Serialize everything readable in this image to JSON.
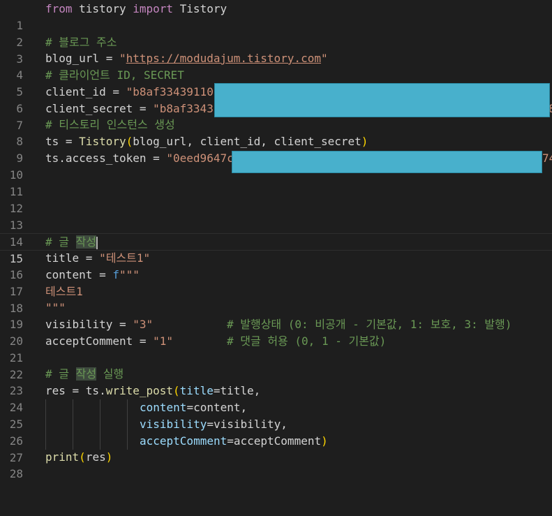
{
  "line_numbers": [
    "1",
    "2",
    "3",
    "4",
    "5",
    "6",
    "7",
    "8",
    "9",
    "10",
    "11",
    "12",
    "13",
    "14",
    "15",
    "16",
    "17",
    "18",
    "19",
    "20",
    "21",
    "22",
    "23",
    "24",
    "25",
    "26",
    "27",
    "28"
  ],
  "code": {
    "l1_from": "from",
    "l1_module": " tistory ",
    "l1_import": "import",
    "l1_class": " Tistory",
    "l3_comment": "# 블로그 주소",
    "l4_var": "blog_url = ",
    "l4_q1": "\"",
    "l4_url": "https://modudajum.tistory.com",
    "l4_q2": "\"",
    "l5_comment": "# 클라이언트 ID, SECRET",
    "l6_var": "client_id = ",
    "l6_str": "\"b8af33439110",
    "l7_var": "client_secret = ",
    "l7_str": "\"b8af3343",
    "l7_tail": "8",
    "l8_comment": "# 티스토리 인스턴스 생성",
    "l9_a": "ts = ",
    "l9_fn": "Tistory",
    "l9_p1": "(",
    "l9_args": "blog_url, client_id, client_secret",
    "l9_p2": ")",
    "l10_var": "ts.access_token = ",
    "l10_str": "\"0eed9647c",
    "l10_tail": "74",
    "l15_c1": "# 글 ",
    "l15_c2": "작성",
    "l16_var": "title = ",
    "l16_str": "\"테스트1\"",
    "l17_var": "content = ",
    "l17_f": "f",
    "l17_str": "\"\"\"",
    "l18_str": "테스트1",
    "l19_str": "\"\"\"",
    "l20_var": "visibility = ",
    "l20_str": "\"3\"",
    "l20_comment": "# 발행상태 (0: 비공개 - 기본값, 1: 보호, 3: 발행)",
    "l21_var": "acceptComment = ",
    "l21_str": "\"1\"",
    "l21_comment": "# 댓글 허용 (0, 1 - 기본값)",
    "l23_c1": "# 글 ",
    "l23_c2": "작성",
    "l23_c3": " 실행",
    "l24_a": "res = ts.",
    "l24_fn": "write_post",
    "l24_p": "(",
    "l24_k": "title",
    "l24_v": "=title,",
    "l25_k": "content",
    "l25_v": "=content,",
    "l26_k": "visibility",
    "l26_v": "=visibility,",
    "l27_k": "acceptComment",
    "l27_v": "=acceptComment",
    "l27_p": ")",
    "l28_fn": "print",
    "l28_p1": "(",
    "l28_arg": "res",
    "l28_p2": ")"
  },
  "colors": {
    "background": "#1e1e1e",
    "keyword": "#c586c0",
    "string": "#ce9178",
    "comment": "#6a9955",
    "variable": "#9cdcfe",
    "function": "#dcdcaa",
    "redaction": "#48b0cc"
  }
}
